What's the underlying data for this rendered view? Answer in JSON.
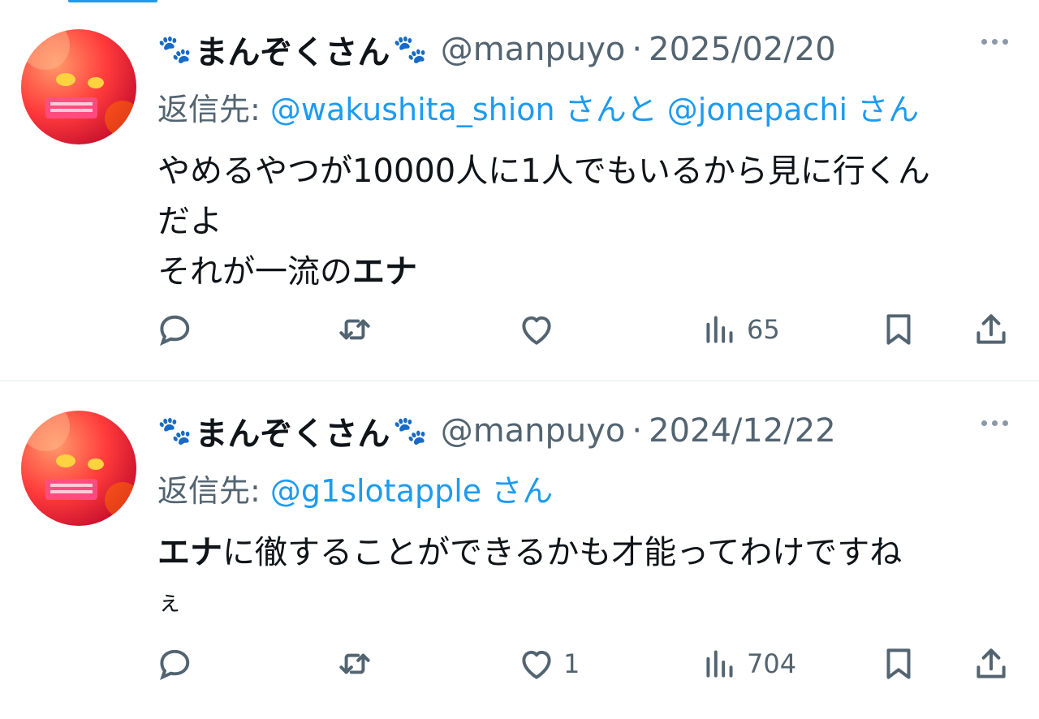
{
  "tweets": [
    {
      "display_name": "まんぞくさん",
      "paw_left": "🐾",
      "paw_right": "🐾",
      "handle": "@manpuyo",
      "separator": "·",
      "date": "2025/02/20",
      "reply_prefix": "返信先:",
      "reply_mention_1": "@wakushita_shion",
      "reply_join": "さんと",
      "reply_mention_2": "@jonepachi",
      "reply_suffix": "さん",
      "body_line_1": "やめるやつが10000人に1人でもいるから見に行くん",
      "body_line_2": "だよ",
      "body_line_3_plain": "それが一流の",
      "body_line_3_bold": "エナ",
      "reply_count": "",
      "retweet_count": "",
      "like_count": "",
      "view_count": "65"
    },
    {
      "display_name": "まんぞくさん",
      "paw_left": "🐾",
      "paw_right": "🐾",
      "handle": "@manpuyo",
      "separator": "·",
      "date": "2024/12/22",
      "reply_prefix": "返信先:",
      "reply_mention_1": "@g1slotapple",
      "reply_suffix": "さん",
      "body_line_1_bold": "エナ",
      "body_line_1_plain": "に徹することができるかも才能ってわけですね",
      "body_line_2": "ぇ",
      "reply_count": "",
      "retweet_count": "",
      "like_count": "1",
      "view_count": "704"
    }
  ],
  "icons": {
    "reply": "reply-bubble-icon",
    "retweet": "retweet-icon",
    "like": "heart-icon",
    "views": "views-chart-icon",
    "bookmark": "bookmark-icon",
    "share": "share-upload-icon",
    "more": "more-dots-icon"
  },
  "colors": {
    "link": "#1d9bf0",
    "secondary_text": "#536471",
    "primary_text": "#0f1419",
    "divider": "#eff3f4"
  }
}
